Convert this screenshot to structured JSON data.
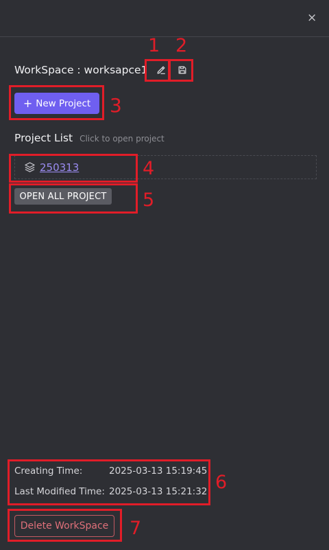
{
  "header": {
    "close_glyph": "×",
    "close_icon": "close-icon"
  },
  "workspace": {
    "title": "WorkSpace : worksapce1",
    "edit_icon": "pencil-icon",
    "save_icon": "save-icon"
  },
  "actions": {
    "new_project_plus": "+",
    "new_project_label": "New Project"
  },
  "project_list": {
    "title": "Project List",
    "hint": "Click to open project",
    "items": [
      {
        "name": "250313",
        "icon": "layers-icon"
      }
    ],
    "open_all_label": "OPEN ALL PROJECT"
  },
  "info": {
    "creating_label": "Creating Time:",
    "creating_value": "2025-03-13 15:19:45",
    "modified_label": "Last Modified Time:",
    "modified_value": "2025-03-13 15:21:32"
  },
  "danger": {
    "delete_label": "Delete WorkSpace"
  },
  "annotations": {
    "labels": [
      "1",
      "2",
      "3",
      "4",
      "5",
      "6",
      "7"
    ],
    "color": "#e11d28"
  },
  "colors": {
    "background": "#2e2f34",
    "primary": "#6f5ff0",
    "link": "#9b8cf2",
    "danger": "#e0707a",
    "secondary_button": "#5a5b62"
  }
}
